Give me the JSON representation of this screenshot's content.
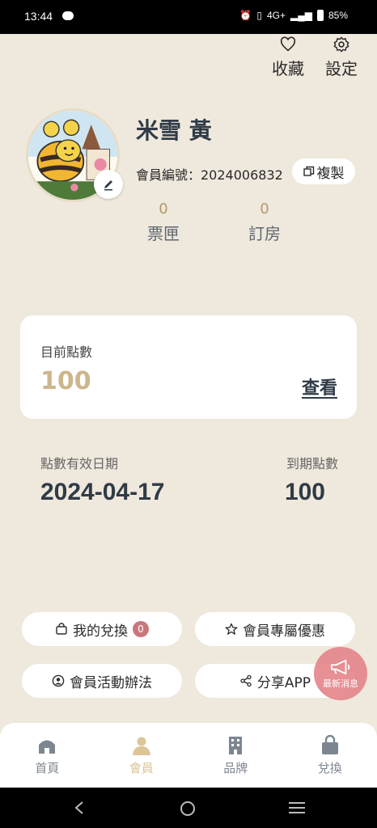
{
  "status_bar": {
    "time": "13:44",
    "network": "4G+",
    "battery": "85%"
  },
  "top_actions": {
    "favorites_label": "收藏",
    "settings_label": "設定"
  },
  "profile": {
    "name": "米雪 黃",
    "member_no_label": "會員編號：2024006832",
    "copy_label": "複製",
    "stats": [
      {
        "value": "0",
        "label": "票匣"
      },
      {
        "value": "0",
        "label": "訂房"
      }
    ]
  },
  "points": {
    "label": "目前點數",
    "value": "100",
    "view_label": "查看"
  },
  "expiry": {
    "date_label": "點數有效日期",
    "date_value": "2024-04-17",
    "points_label": "到期點數",
    "points_value": "100"
  },
  "actions": {
    "redeem_label": "我的兌換",
    "redeem_count": "0",
    "activity_label": "會員活動辦法",
    "exclusive_label": "會員專屬優惠",
    "share_label": "分享APP"
  },
  "float_button": {
    "label": "最新消息"
  },
  "bottom_nav": [
    "首頁",
    "會員",
    "品牌",
    "兌換"
  ],
  "colors": {
    "accent": "#dcc596",
    "background": "#efe8dc",
    "badge": "#c9777c"
  }
}
